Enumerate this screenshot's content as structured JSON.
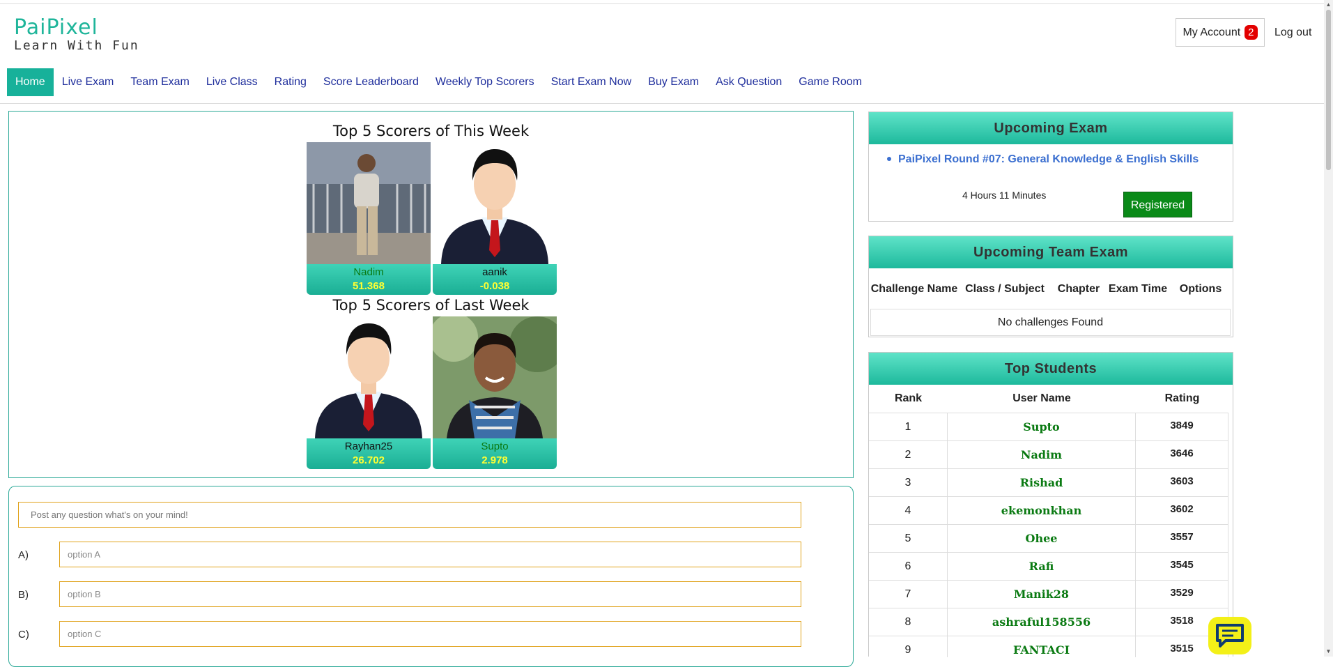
{
  "header": {
    "logo_main": "PaiPixel",
    "logo_sub": "Learn With Fun",
    "my_account_label": "My Account",
    "notification_count": "2",
    "logout_label": "Log out"
  },
  "nav": {
    "items": [
      "Home",
      "Live Exam",
      "Team Exam",
      "Live Class",
      "Rating",
      "Score Leaderboard",
      "Weekly Top Scorers",
      "Start Exam Now",
      "Buy Exam",
      "Ask Question",
      "Game Room"
    ]
  },
  "scorers": {
    "this_week_title": "Top 5 Scorers of This Week",
    "last_week_title": "Top 5 Scorers of Last Week",
    "this_week": [
      {
        "name": "Nadim",
        "score": "51.368"
      },
      {
        "name": "aanik",
        "score": "-0.038"
      }
    ],
    "last_week": [
      {
        "name": "Rayhan25",
        "score": "26.702"
      },
      {
        "name": "Supto",
        "score": "2.978"
      }
    ]
  },
  "composer": {
    "question_placeholder": "Post any question what's on your mind!",
    "options": [
      {
        "label": "A)",
        "placeholder": "option A"
      },
      {
        "label": "B)",
        "placeholder": "option B"
      },
      {
        "label": "C)",
        "placeholder": "option C"
      }
    ]
  },
  "upcoming_exam": {
    "title": "Upcoming Exam",
    "exam_name": "PaiPixel Round #07: General Knowledge & English Skills",
    "time_left": "4 Hours 11 Minutes",
    "status_button": "Registered"
  },
  "team_exam": {
    "title": "Upcoming Team Exam",
    "columns": [
      "Challenge Name",
      "Class / Subject",
      "Chapter",
      "Exam Time",
      "Options"
    ],
    "empty_text": "No challenges Found"
  },
  "top_students": {
    "title": "Top Students",
    "columns": [
      "Rank",
      "User Name",
      "Rating"
    ],
    "rows": [
      {
        "rank": "1",
        "user": "Supto",
        "rating": "3849"
      },
      {
        "rank": "2",
        "user": "Nadim",
        "rating": "3646"
      },
      {
        "rank": "3",
        "user": "Rishad",
        "rating": "3603"
      },
      {
        "rank": "4",
        "user": "ekemonkhan",
        "rating": "3602"
      },
      {
        "rank": "5",
        "user": "Ohee",
        "rating": "3557"
      },
      {
        "rank": "6",
        "user": "Rafi",
        "rating": "3545"
      },
      {
        "rank": "7",
        "user": "Manik28",
        "rating": "3529"
      },
      {
        "rank": "8",
        "user": "ashraful158556",
        "rating": "3518"
      },
      {
        "rank": "9",
        "user": "FANTACI",
        "rating": "3515"
      }
    ]
  },
  "icons": {
    "chat": "chat-bubble-icon"
  },
  "colors": {
    "accent": "#17b19a",
    "nav_link": "#1f2e9c",
    "score_yellow": "#ffff33",
    "registered_green": "#0a8a18",
    "user_green": "#0a7a12",
    "chat_yellow": "#f3f018"
  }
}
